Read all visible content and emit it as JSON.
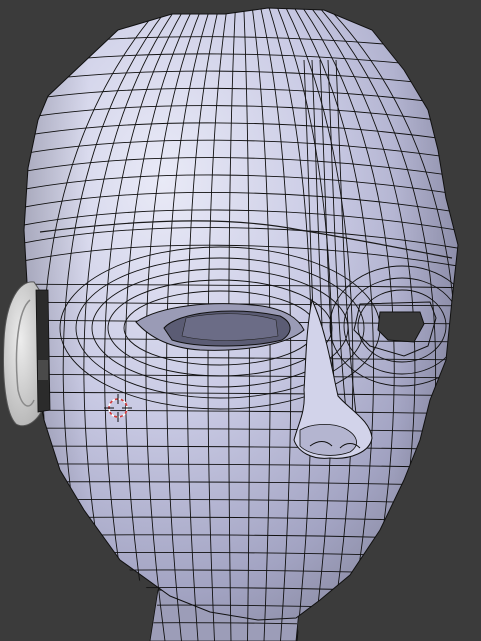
{
  "viewport": {
    "background_color": "#3b3b3b",
    "mesh_color_light": "#e4e5f4",
    "mesh_color_mid": "#b9bad5",
    "mesh_color_shadow": "#7d7e98",
    "wire_color": "#111111",
    "ear_color": "#d6d6d6",
    "cursor_colors": [
      "#d43a3a",
      "#ffffff"
    ],
    "cursor_icon": "3d-cursor-crosshair-icon"
  }
}
